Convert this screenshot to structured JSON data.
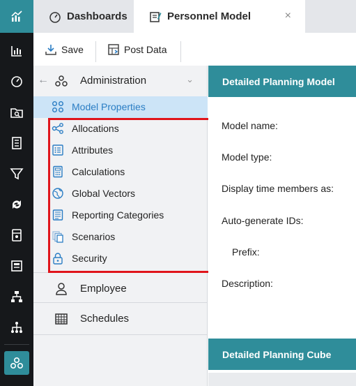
{
  "tabs": [
    {
      "label": "Dashboards",
      "icon": "gauge-icon"
    },
    {
      "label": "Personnel Model",
      "icon": "model-edit-icon"
    }
  ],
  "tab_close": "×",
  "toolbar": {
    "save_label": "Save",
    "post_label": "Post Data"
  },
  "panel": {
    "back": "←",
    "header": "Administration",
    "chevron": "⌄",
    "items": [
      {
        "label": "Model Properties",
        "icon": "model-properties-icon",
        "selected": true
      },
      {
        "label": "Allocations",
        "icon": "share-nodes-icon"
      },
      {
        "label": "Attributes",
        "icon": "list-icon"
      },
      {
        "label": "Calculations",
        "icon": "calculator-icon"
      },
      {
        "label": "Global Vectors",
        "icon": "globe-icon"
      },
      {
        "label": "Reporting Categories",
        "icon": "report-list-icon"
      },
      {
        "label": "Scenarios",
        "icon": "copy-icon"
      },
      {
        "label": "Security",
        "icon": "lock-icon"
      }
    ],
    "groups": [
      {
        "label": "Employee",
        "icon": "person-icon"
      },
      {
        "label": "Schedules",
        "icon": "calendar-grid-icon"
      }
    ]
  },
  "content": {
    "section1": "Detailed Planning Model",
    "fields": [
      "Model name:",
      "Model type:",
      "Display time members as:",
      "Auto-generate IDs:",
      "Prefix:",
      "Description:"
    ],
    "section2": "Detailed Planning Cube"
  },
  "colors": {
    "accent": "#2f8d9a",
    "rail": "#16181b",
    "selected_bg": "#cce4f7",
    "selected_text": "#2a7dc4",
    "highlight": "#e0141b"
  }
}
